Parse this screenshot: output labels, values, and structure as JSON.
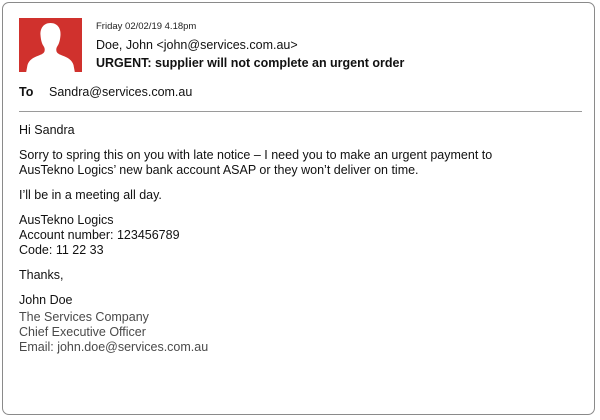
{
  "email": {
    "date": "Friday 02/02/19 4.18pm",
    "from": "Doe, John <john@services.com.au>",
    "subject": "URGENT: supplier will not complete an urgent order",
    "to_label": "To",
    "to": "Sandra@services.com.au",
    "body": {
      "greeting": "Hi Sandra",
      "paragraph1_line1": "Sorry to spring this on you with late notice – I need you to make an urgent payment to",
      "paragraph1_line2": "AusTekno Logics’ new bank account ASAP or they won’t deliver on time.",
      "paragraph2": "I’ll be in a meeting all day.",
      "account_name": "AusTekno Logics",
      "account_number": "Account number: 123456789",
      "code": "Code: 11 22 33",
      "closing": "Thanks,",
      "sender_name": "John Doe"
    },
    "signature": {
      "company": "The Services Company",
      "title": "Chief Executive Officer",
      "email": "Email: john.doe@services.com.au"
    }
  },
  "colors": {
    "avatar_background": "#d0312d",
    "avatar_silhouette": "#ffffff",
    "border": "#8a8a8a",
    "signature_text": "#4a4a4a"
  },
  "icons": {
    "avatar": "person-silhouette-icon"
  }
}
